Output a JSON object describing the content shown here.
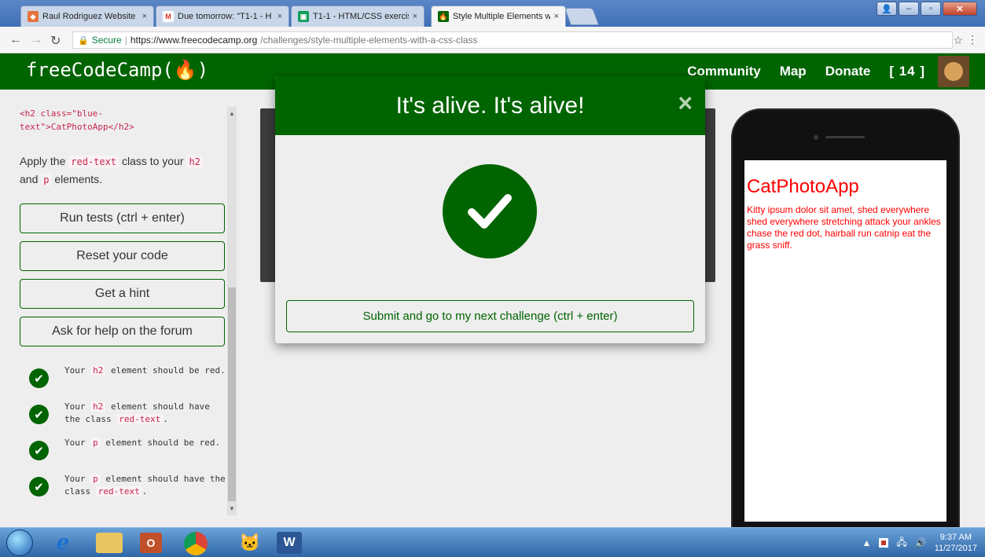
{
  "browser": {
    "tabs": [
      {
        "title": "Raul Rodriguez Website",
        "favicon": "codepen-icon",
        "active": false
      },
      {
        "title": "Due tomorrow: \"T1-1 - H",
        "favicon": "gmail-icon",
        "active": false
      },
      {
        "title": "T1-1 - HTML/CSS exercis",
        "favicon": "classroom-icon",
        "active": false
      },
      {
        "title": "Style Multiple Elements w",
        "favicon": "fcc-icon",
        "active": true
      }
    ],
    "tab_close": "×",
    "secure_label": "Secure",
    "url_host": "https://www.freecodecamp.org",
    "url_path": "/challenges/style-multiple-elements-with-a-css-class"
  },
  "navbar": {
    "logo": "freeCodeCamp(🔥)",
    "links": [
      "Community",
      "Map",
      "Donate"
    ],
    "points": "[ 14 ]"
  },
  "left": {
    "code_snippet": "<h2 class=\"blue-text\">CatPhotoApp</h2>",
    "instruction_pre": "Apply the ",
    "instruction_code1": "red-text",
    "instruction_mid": " class to your ",
    "instruction_code2": "h2",
    "instruction_mid2": " and ",
    "instruction_code3": "p",
    "instruction_post": " elements.",
    "buttons": {
      "run": "Run tests (ctrl + enter)",
      "reset": "Reset your code",
      "hint": "Get a hint",
      "help": "Ask for help on the forum"
    },
    "tests": [
      {
        "pre": "Your ",
        "code1": "h2",
        "mid": " element should be red.",
        "code2": "",
        "post": ""
      },
      {
        "pre": "Your ",
        "code1": "h2",
        "mid": " element should have the class ",
        "code2": "red-text",
        "post": "."
      },
      {
        "pre": "Your ",
        "code1": "p",
        "mid": " element should be red.",
        "code2": "",
        "post": ""
      },
      {
        "pre": "Your ",
        "code1": "p",
        "mid": " element should have the class ",
        "code2": "red-text",
        "post": "."
      }
    ]
  },
  "preview": {
    "heading": "CatPhotoApp",
    "paragraph": "Kitty ipsum dolor sit amet, shed everywhere shed everywhere stretching attack your ankles chase the red dot, hairball run catnip eat the grass sniff."
  },
  "modal": {
    "title": "It's alive. It's alive!",
    "close": "×",
    "submit": "Submit and go to my next challenge (ctrl + enter)"
  },
  "taskbar": {
    "time": "9:37 AM",
    "date": "11/27/2017"
  },
  "colors": {
    "fcc_green": "#006400",
    "preview_red": "#ff0000",
    "code_pink": "#c7254e"
  }
}
